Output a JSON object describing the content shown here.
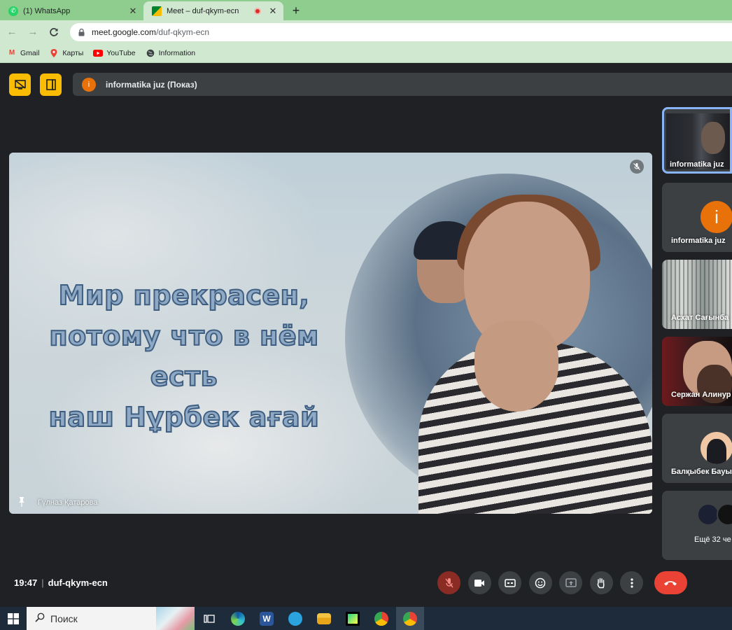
{
  "browser": {
    "tabs": [
      {
        "title": "(1) WhatsApp",
        "active": false
      },
      {
        "title": "Meet – duf-qkym-ecn",
        "active": true,
        "recording": true
      }
    ],
    "address": {
      "host": "meet.google.com",
      "path": "/duf-qkym-ecn"
    },
    "bookmarks": [
      {
        "label": "Gmail",
        "icon": "gmail-icon"
      },
      {
        "label": "Карты",
        "icon": "maps-icon"
      },
      {
        "label": "YouTube",
        "icon": "youtube-icon"
      },
      {
        "label": "Information",
        "icon": "globe-icon"
      }
    ]
  },
  "meet": {
    "presenter_label": "informatika juz (Показ)",
    "presenter_initial": "i",
    "main": {
      "caption_lines": [
        "Мир прекрасен,",
        "потому что в нём есть",
        "наш Нұрбек ағай"
      ],
      "owner_name": "Гүлназ Қатарова"
    },
    "participants": [
      {
        "name": "informatika juz",
        "kind": "screen"
      },
      {
        "name": "informatika juz",
        "kind": "avatar",
        "initial": "i"
      },
      {
        "name": "Асхат Сағынба",
        "kind": "camera"
      },
      {
        "name": "Сержан Алинур",
        "kind": "camera"
      },
      {
        "name": "Балқыбек Бауы",
        "kind": "avatar-image"
      }
    ],
    "more_label": "Ещё 32 че",
    "time": "19:47",
    "meeting_code": "duf-qkym-ecn"
  },
  "taskbar": {
    "search_placeholder": "Поиск",
    "apps": [
      "task-view-icon",
      "edge-icon",
      "word-icon",
      "telegram-icon",
      "explorer-icon",
      "pycharm-icon",
      "chrome-icon",
      "chrome-icon"
    ]
  },
  "colors": {
    "accent_green": "#8fcd8f",
    "meet_bg": "#202124",
    "hangup_red": "#ea4335",
    "presenter_orange": "#e8710a",
    "highlight_yellow": "#fbbc04"
  }
}
